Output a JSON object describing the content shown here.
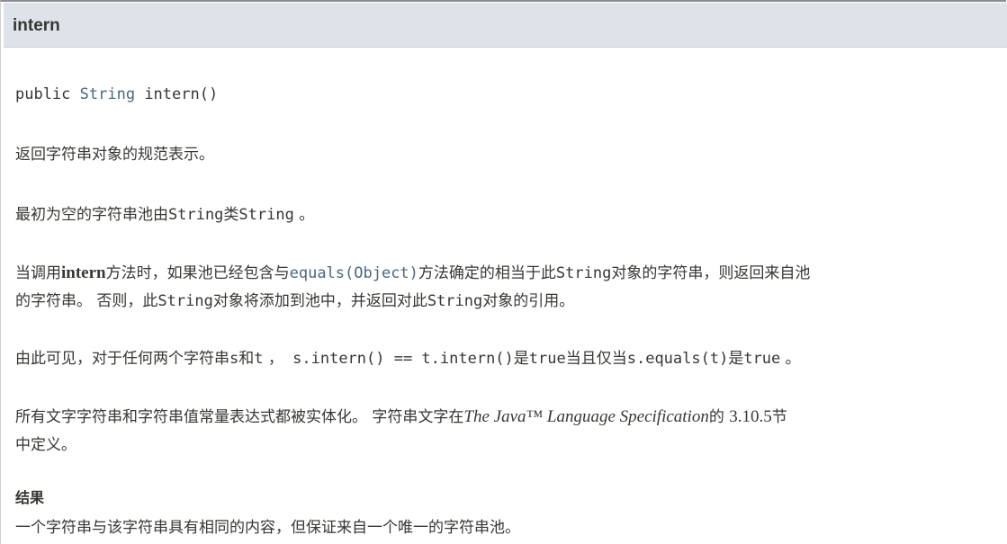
{
  "header": {
    "title": "intern"
  },
  "signature": {
    "modifier": "public ",
    "return_type": "String",
    "method": " intern()"
  },
  "description": {
    "p1": "返回字符串对象的规范表示。",
    "p2": {
      "text1": "最初为空的字符串池由",
      "code1": "String",
      "text2": "类",
      "code2": "String",
      "text3": " 。"
    },
    "p3": {
      "text1": "当调用",
      "bold1": "intern",
      "text2": "方法时，如果池已经包含与",
      "link1": "equals(Object)",
      "text3": "方法确定的相当于此",
      "code1": "String",
      "text4": "对象的字符串，则返回来自池",
      "text5": "的字符串。 否则，此",
      "code2": "String",
      "text6": "对象将添加到池中，并返回对此",
      "code3": "String",
      "text7": "对象的引用。"
    },
    "p4": {
      "text1": "由此可见，对于任何两个字符串",
      "code1": "s",
      "text2": "和",
      "code2": "t",
      "text3": " ，",
      "code3": " s.intern() == t.intern()",
      "text4": "是",
      "code4": "true",
      "text5": "当且仅当",
      "code5": "s.equals(t)",
      "text6": "是",
      "code6": "true",
      "text7": " 。"
    },
    "p5": {
      "text1": "所有文字字符串和字符串值常量表达式都被实体化。 字符串文字在",
      "italic1": "The Java™ Language Specification",
      "text2": "的 ",
      "section": "3.10.5",
      "text3": "节",
      "text4": "中定义。"
    }
  },
  "result": {
    "heading": "结果",
    "text": "一个字符串与该字符串具有相同的内容，但保证来自一个唯一的字符串池。"
  }
}
